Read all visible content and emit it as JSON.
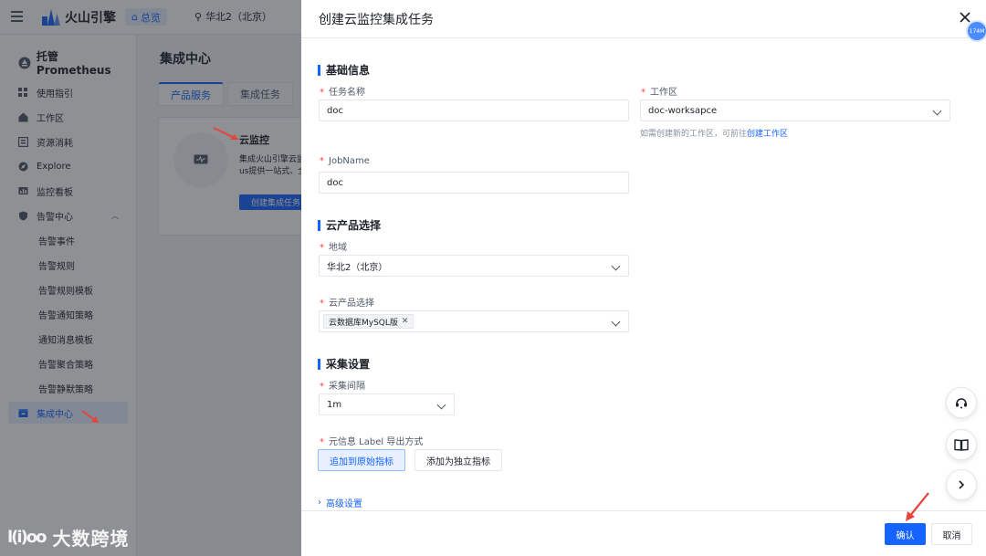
{
  "topbar": {
    "brand": "火山引擎",
    "overview": "总览",
    "region": "华北2（北京）"
  },
  "sidebar": {
    "title": "托管 Prometheus",
    "items": [
      {
        "label": "使用指引",
        "icon": "guide-icon"
      },
      {
        "label": "工作区",
        "icon": "home-icon"
      },
      {
        "label": "资源消耗",
        "icon": "usage-icon"
      },
      {
        "label": "Explore",
        "icon": "explore-icon"
      },
      {
        "label": "监控看板",
        "icon": "dashboard-icon"
      },
      {
        "label": "告警中心",
        "icon": "shield-icon"
      }
    ],
    "alert_subitems": [
      "告警事件",
      "告警规则",
      "告警规则模板",
      "告警通知策略",
      "通知消息模板",
      "告警聚合策略",
      "告警静默策略"
    ],
    "active_item": "集成中心"
  },
  "main": {
    "title": "集成中心",
    "tabs": [
      "产品服务",
      "集成任务"
    ],
    "card": {
      "title": "云监控",
      "desc_line1": "集成火山引擎云监",
      "desc_line2": "us提供一站式、全",
      "button": "创建集成任务"
    }
  },
  "drawer": {
    "title": "创建云监控集成任务",
    "mem_badge": "174M",
    "sections": {
      "basic": "基础信息",
      "product": "云产品选择",
      "collect": "采集设置"
    },
    "fields": {
      "task_name": {
        "label": "任务名称",
        "value": "doc"
      },
      "workspace": {
        "label": "工作区",
        "value": "doc-worksapce"
      },
      "workspace_hint": "如需创建新的工作区，可前往",
      "workspace_link": "创建工作区",
      "job_name": {
        "label": "JobName",
        "value": "doc"
      },
      "region": {
        "label": "地域",
        "value": "华北2（北京）"
      },
      "product": {
        "label": "云产品选择",
        "tag": "云数据库MySQL版"
      },
      "interval": {
        "label": "采集间隔",
        "value": "1m"
      },
      "label_export": {
        "label": "元信息 Label 导出方式",
        "options": [
          "追加到原始指标",
          "添加为独立指标"
        ],
        "selected": "追加到原始指标"
      }
    },
    "advanced": "高级设置",
    "confirm": "确认",
    "cancel": "取消"
  },
  "watermark": {
    "mark": "l(i)oo",
    "text": "大数跨境"
  },
  "colors": {
    "primary": "#1664ff",
    "required": "#f53f3f",
    "annotation": "#e8433d"
  }
}
